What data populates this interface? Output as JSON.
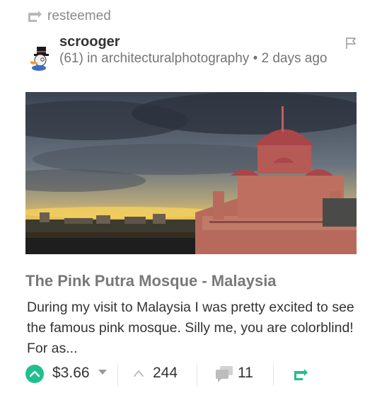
{
  "resteem": {
    "label": "resteemed",
    "icon": "resteem-icon"
  },
  "author": {
    "name": "scrooger",
    "reputation": "(61)",
    "in_label": "in",
    "community": "architecturalphotography",
    "separator": "•",
    "time": "2 days ago",
    "avatar_icon": "duck-avatar",
    "flag_icon": "flag-icon"
  },
  "post": {
    "title": "The Pink Putra Mosque - Malaysia",
    "excerpt": "During my visit to Malaysia I was pretty excited to see the famous pink mosque. Silly me, you are colorblind! For as...",
    "image_icon": "mosque-sunset-photo"
  },
  "footer": {
    "payout": "$3.66",
    "votes": "244",
    "comments": "11"
  },
  "colors": {
    "accent": "#1fbf8f",
    "muted": "#8a8a8a",
    "text": "#333333"
  }
}
